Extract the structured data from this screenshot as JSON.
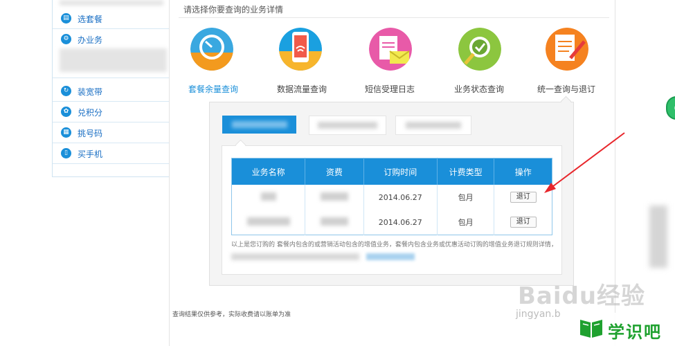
{
  "sidebar": {
    "items": [
      {
        "label": "选套餐",
        "icon": "package-icon"
      },
      {
        "label": "办业务",
        "icon": "gear-icon"
      },
      {
        "label": "装宽带",
        "icon": "broadband-icon"
      },
      {
        "label": "兑积分",
        "icon": "gift-icon"
      },
      {
        "label": "挑号码",
        "icon": "number-grid-icon"
      },
      {
        "label": "买手机",
        "icon": "phone-icon"
      }
    ]
  },
  "main": {
    "heading": "请选择你要查询的业务详情",
    "services": [
      {
        "label": "套餐余量查询",
        "icon": "clock-icon",
        "active": true,
        "color": "#f39a1e"
      },
      {
        "label": "数据流量查询",
        "icon": "mobile-wifi-icon",
        "active": false,
        "color": "#1aa0e0"
      },
      {
        "label": "短信受理日志",
        "icon": "document-mail-icon",
        "active": false,
        "color": "#e85aa8"
      },
      {
        "label": "业务状态查询",
        "icon": "search-check-icon",
        "active": false,
        "color": "#8cc63f"
      },
      {
        "label": "统一查询与退订",
        "icon": "document-pen-icon",
        "active": false,
        "color": "#f58220"
      }
    ],
    "table": {
      "headers": [
        "业务名称",
        "资费",
        "订购时间",
        "计费类型",
        "操作"
      ],
      "rows": [
        {
          "date": "2014.06.27",
          "billing": "包月",
          "action": "退订"
        },
        {
          "date": "2014.06.27",
          "billing": "包月",
          "action": "退订"
        }
      ]
    },
    "note": "以上是您订购的    套餐内包含的或营销活动包含的增值业务，套餐内包含业务或优惠活动订购的增值业务退订规则详情，以套餐",
    "footnote": "查询结果仅供参考，实际收费请以账单为准"
  },
  "watermark": {
    "baidu": "Baidu经验",
    "jingyan": "jingyan.b",
    "brand": "学识吧"
  },
  "colors": {
    "primary": "#1a8fd9",
    "arrow": "#e8262b"
  }
}
